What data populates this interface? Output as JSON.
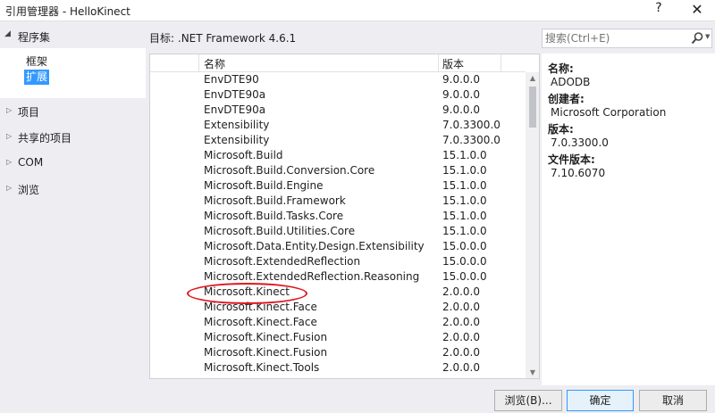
{
  "window": {
    "title": "引用管理器 - HelloKinect",
    "help": "?",
    "close": "✕"
  },
  "nav": {
    "section": "程序集",
    "sub_items": [
      {
        "label": "框架",
        "selected": false
      },
      {
        "label": "扩展",
        "selected": true
      }
    ],
    "nodes": [
      {
        "label": "项目"
      },
      {
        "label": "共享的项目"
      },
      {
        "label": "COM"
      },
      {
        "label": "浏览"
      }
    ]
  },
  "target": {
    "key": "目标:",
    "value": ".NET Framework 4.6.1"
  },
  "search": {
    "placeholder": "搜索(Ctrl+E)",
    "value": ""
  },
  "list": {
    "columns": {
      "name": "名称",
      "version": "版本"
    },
    "rows": [
      {
        "name": "EnvDTE90",
        "version": "9.0.0.0"
      },
      {
        "name": "EnvDTE90a",
        "version": "9.0.0.0"
      },
      {
        "name": "EnvDTE90a",
        "version": "9.0.0.0"
      },
      {
        "name": "Extensibility",
        "version": "7.0.3300.0"
      },
      {
        "name": "Extensibility",
        "version": "7.0.3300.0"
      },
      {
        "name": "Microsoft.Build",
        "version": "15.1.0.0"
      },
      {
        "name": "Microsoft.Build.Conversion.Core",
        "version": "15.1.0.0"
      },
      {
        "name": "Microsoft.Build.Engine",
        "version": "15.1.0.0"
      },
      {
        "name": "Microsoft.Build.Framework",
        "version": "15.1.0.0"
      },
      {
        "name": "Microsoft.Build.Tasks.Core",
        "version": "15.1.0.0"
      },
      {
        "name": "Microsoft.Build.Utilities.Core",
        "version": "15.1.0.0"
      },
      {
        "name": "Microsoft.Data.Entity.Design.Extensibility",
        "version": "15.0.0.0"
      },
      {
        "name": "Microsoft.ExtendedReflection",
        "version": "15.0.0.0"
      },
      {
        "name": "Microsoft.ExtendedReflection.Reasoning",
        "version": "15.0.0.0"
      },
      {
        "name": "Microsoft.Kinect",
        "version": "2.0.0.0"
      },
      {
        "name": "Microsoft.Kinect.Face",
        "version": "2.0.0.0"
      },
      {
        "name": "Microsoft.Kinect.Face",
        "version": "2.0.0.0"
      },
      {
        "name": "Microsoft.Kinect.Fusion",
        "version": "2.0.0.0"
      },
      {
        "name": "Microsoft.Kinect.Fusion",
        "version": "2.0.0.0"
      },
      {
        "name": "Microsoft.Kinect.Tools",
        "version": "2.0.0.0"
      }
    ]
  },
  "details": {
    "name_label": "名称:",
    "name_value": "ADODB",
    "creator_label": "创建者:",
    "creator_value": "Microsoft Corporation",
    "version_label": "版本:",
    "version_value": "7.0.3300.0",
    "file_version_label": "文件版本:",
    "file_version_value": "7.10.6070"
  },
  "buttons": {
    "browse": "浏览(B)...",
    "ok": "确定",
    "cancel": "取消"
  },
  "colors": {
    "selection": "#3399ff",
    "annotation": "#e0141e",
    "accent_border": "#3399ff"
  }
}
